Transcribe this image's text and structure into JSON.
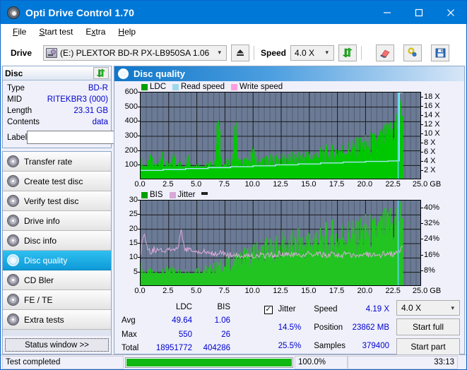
{
  "window": {
    "title": "Opti Drive Control 1.70",
    "icon": "disc-icon",
    "minimize": "minimize-icon",
    "maximize": "maximize-icon",
    "close": "close-icon"
  },
  "menu": [
    {
      "label": "File"
    },
    {
      "label": "Start test"
    },
    {
      "label": "Extra"
    },
    {
      "label": "Help"
    }
  ],
  "toolbar": {
    "drive_label": "Drive",
    "drive_value": "(E:)  PLEXTOR BD-R  PX-LB950SA 1.06",
    "eject_icon": "eject-icon",
    "speed_label": "Speed",
    "speed_value": "4.0 X",
    "refresh_icon": "refresh-icon",
    "erase_icon": "eraser-icon",
    "tools_icon": "tools-icon",
    "save_icon": "save-icon"
  },
  "disc": {
    "header": "Disc",
    "refresh_icon": "refresh-icon",
    "rows": [
      {
        "key": "Type",
        "value": "BD-R"
      },
      {
        "key": "MID",
        "value": "RITEKBR3 (000)"
      },
      {
        "key": "Length",
        "value": "23.31 GB"
      },
      {
        "key": "Contents",
        "value": "data"
      }
    ],
    "label_key": "Label",
    "label_value": "",
    "label_placeholder": "",
    "label_icon": "cd-icon"
  },
  "nav": {
    "items": [
      {
        "label": "Transfer rate",
        "icon": "disc-rate-icon",
        "active": false
      },
      {
        "label": "Create test disc",
        "icon": "disc-create-icon",
        "active": false
      },
      {
        "label": "Verify test disc",
        "icon": "disc-verify-icon",
        "active": false
      },
      {
        "label": "Drive info",
        "icon": "drive-info-icon",
        "active": false
      },
      {
        "label": "Disc info",
        "icon": "disc-info-icon",
        "active": false
      },
      {
        "label": "Disc quality",
        "icon": "disc-quality-icon",
        "active": true
      },
      {
        "label": "CD Bler",
        "icon": "cd-bler-icon",
        "active": false
      },
      {
        "label": "FE / TE",
        "icon": "fete-icon",
        "active": false
      },
      {
        "label": "Extra tests",
        "icon": "extra-tests-icon",
        "active": false
      }
    ],
    "status_window": "Status window >>"
  },
  "main": {
    "header": "Disc quality",
    "header_icon": "disc-quality-icon"
  },
  "stats": {
    "col_headers": [
      "",
      "LDC",
      "BIS"
    ],
    "rows": [
      {
        "label": "Avg",
        "ldc": "49.64",
        "bis": "1.06",
        "jitter": "14.5%"
      },
      {
        "label": "Max",
        "ldc": "550",
        "bis": "26",
        "jitter": "25.5%"
      },
      {
        "label": "Total",
        "ldc": "18951772",
        "bis": "404286",
        "jitter": ""
      }
    ],
    "jitter_label": "Jitter",
    "jitter_checked": true,
    "speed_label": "Speed",
    "speed_value": "4.19 X",
    "position_label": "Position",
    "position_value": "23862 MB",
    "samples_label": "Samples",
    "samples_value": "379400",
    "speed_select": "4.0 X",
    "start_full": "Start full",
    "start_part": "Start part"
  },
  "statusbar": {
    "message": "Test completed",
    "percent": "100.0%",
    "percent_value": 100,
    "elapsed": "33:13"
  },
  "colors": {
    "accent": "#0078d7",
    "plot_bg": "#6b7a95",
    "ldc": "#00b000",
    "bis": "#00a000",
    "read_speed": "#7ec8e8",
    "write_speed": "#ff8ad8",
    "jitter": "#d8a8d8",
    "value_text": "#0000cd",
    "progress": "#12b812"
  },
  "chart_data": [
    {
      "type": "line",
      "title": "Disc quality - LDC / Read speed",
      "xlabel": "GB",
      "ylabel": "",
      "xlim": [
        0,
        25
      ],
      "ylim": [
        0,
        600
      ],
      "xticks": [
        "0.0",
        "2.5",
        "5.0",
        "7.5",
        "10.0",
        "12.5",
        "15.0",
        "17.5",
        "20.0",
        "22.5",
        "25.0 GB"
      ],
      "yticks": [
        "100",
        "200",
        "300",
        "400",
        "500",
        "600"
      ],
      "y2ticks": [
        "2 X",
        "4 X",
        "6 X",
        "8 X",
        "10 X",
        "12 X",
        "14 X",
        "16 X",
        "18 X"
      ],
      "y2lim": [
        0,
        19
      ],
      "grid": true,
      "legend": [
        {
          "name": "LDC",
          "color": "#00b000"
        },
        {
          "name": "Read speed",
          "color": "#7ec8e8"
        },
        {
          "name": "Write speed",
          "color": "#ff8ad8"
        }
      ],
      "series": [
        {
          "name": "LDC",
          "kind": "impulse",
          "color": "#00c800",
          "x": [
            0.0,
            0.3,
            0.6,
            0.9,
            1.2,
            1.5,
            1.8,
            2.1,
            2.4,
            2.7,
            3.0,
            3.3,
            3.6,
            3.9,
            4.2,
            4.5,
            4.8,
            5.1,
            5.4,
            5.7,
            6.0,
            6.3,
            6.6,
            6.9,
            7.2,
            7.5,
            7.8,
            8.1,
            8.4,
            8.7,
            9.0,
            9.3,
            9.6,
            9.9,
            10.2,
            10.5,
            10.8,
            11.1,
            11.4,
            11.7,
            12.0,
            12.3,
            12.6,
            12.9,
            13.2,
            13.5,
            13.8,
            14.1,
            14.4,
            14.7,
            15.0,
            15.3,
            15.6,
            15.9,
            16.2,
            16.5,
            16.8,
            17.1,
            17.4,
            17.7,
            18.0,
            18.3,
            18.6,
            18.9,
            19.2,
            19.5,
            19.8,
            20.1,
            20.4,
            20.7,
            21.0,
            21.3,
            21.6,
            21.9,
            22.2,
            22.5,
            22.8,
            23.0,
            23.2
          ],
          "y": [
            125,
            90,
            95,
            140,
            95,
            100,
            190,
            95,
            100,
            90,
            180,
            95,
            100,
            95,
            180,
            95,
            90,
            95,
            100,
            95,
            95,
            100,
            105,
            410,
            120,
            110,
            115,
            110,
            400,
            115,
            115,
            120,
            125,
            200,
            130,
            125,
            130,
            135,
            130,
            135,
            140,
            135,
            140,
            145,
            140,
            150,
            145,
            150,
            155,
            160,
            155,
            160,
            165,
            170,
            175,
            185,
            190,
            180,
            195,
            200,
            195,
            205,
            210,
            215,
            220,
            230,
            225,
            240,
            250,
            245,
            260,
            270,
            280,
            300,
            320,
            350,
            380,
            430,
            480
          ]
        },
        {
          "name": "Read speed",
          "kind": "step",
          "color": "#a8e8f8",
          "x": [
            0.0,
            2.0,
            4.0,
            6.0,
            8.0,
            10.0,
            12.0,
            14.0,
            16.0,
            18.0,
            20.0,
            22.0,
            22.8,
            23.0
          ],
          "y": [
            2.1,
            2.3,
            2.5,
            2.7,
            2.9,
            3.1,
            3.3,
            3.5,
            3.7,
            3.9,
            4.05,
            4.15,
            4.19,
            19.0
          ]
        }
      ]
    },
    {
      "type": "line",
      "title": "Disc quality - BIS / Jitter",
      "xlabel": "GB",
      "ylabel": "",
      "xlim": [
        0,
        25
      ],
      "ylim": [
        0,
        30
      ],
      "xticks": [
        "0.0",
        "2.5",
        "5.0",
        "7.5",
        "10.0",
        "12.5",
        "15.0",
        "17.5",
        "20.0",
        "22.5",
        "25.0 GB"
      ],
      "yticks": [
        "5",
        "10",
        "15",
        "20",
        "25",
        "30"
      ],
      "y2ticks": [
        "8%",
        "16%",
        "24%",
        "32%",
        "40%"
      ],
      "y2lim": [
        0,
        44
      ],
      "grid": true,
      "legend": [
        {
          "name": "BIS",
          "color": "#00b000"
        },
        {
          "name": "Jitter",
          "color": "#d8a8d8"
        }
      ],
      "series": [
        {
          "name": "BIS",
          "kind": "impulse",
          "color": "#22c422",
          "x": [
            0.0,
            0.3,
            0.6,
            0.9,
            1.2,
            1.5,
            1.8,
            2.1,
            2.4,
            2.7,
            3.0,
            3.3,
            3.6,
            3.9,
            4.2,
            4.5,
            4.8,
            5.1,
            5.4,
            5.7,
            6.0,
            6.3,
            6.6,
            6.9,
            7.2,
            7.5,
            7.8,
            8.1,
            8.4,
            8.7,
            9.0,
            9.3,
            9.6,
            9.9,
            10.2,
            10.5,
            10.8,
            11.1,
            11.4,
            11.7,
            12.0,
            12.3,
            12.6,
            12.9,
            13.2,
            13.5,
            13.8,
            14.1,
            14.4,
            14.7,
            15.0,
            15.3,
            15.6,
            15.9,
            16.2,
            16.5,
            16.8,
            17.1,
            17.4,
            17.7,
            18.0,
            18.3,
            18.6,
            18.9,
            19.2,
            19.5,
            19.8,
            20.1,
            20.4,
            20.7,
            21.0,
            21.3,
            21.6,
            21.9,
            22.2,
            22.5,
            22.8,
            23.0,
            23.2
          ],
          "y": [
            7,
            5,
            4.5,
            5,
            4,
            5,
            4.5,
            5,
            5.5,
            5,
            6.5,
            5,
            4.5,
            5,
            5,
            4.5,
            5,
            6,
            5,
            6,
            5.5,
            6,
            6.5,
            7,
            8,
            7,
            9,
            8,
            10,
            9,
            10,
            11,
            10,
            12,
            11,
            13,
            12,
            14,
            13,
            12,
            14,
            13,
            15,
            14,
            13,
            15,
            14,
            16,
            15,
            14,
            16,
            15,
            17,
            16,
            15,
            17,
            16,
            18,
            17,
            16,
            18,
            17,
            19,
            18,
            17,
            19,
            18,
            20,
            19,
            18,
            20,
            19,
            21,
            20,
            22,
            21,
            23,
            24,
            26
          ]
        },
        {
          "name": "Jitter",
          "kind": "line",
          "color": "#dda8dd",
          "x": [
            0.0,
            0.3,
            0.6,
            0.9,
            1.2,
            1.5,
            1.8,
            2.1,
            2.4,
            2.7,
            3.0,
            3.3,
            3.6,
            3.9,
            4.2,
            4.5,
            4.8,
            5.1,
            5.4,
            5.7,
            6.0,
            6.3,
            6.6,
            6.9,
            7.2,
            7.5,
            7.8,
            8.1,
            8.4,
            8.7,
            9.0,
            9.3,
            9.6,
            9.9,
            10.2,
            10.5,
            10.8,
            11.1,
            11.4,
            11.7,
            12.0,
            12.3,
            12.6,
            12.9,
            13.2,
            13.5,
            13.8,
            14.1,
            14.4,
            14.7,
            15.0,
            15.3,
            15.6,
            15.9,
            16.2,
            16.5,
            16.8,
            17.1,
            17.4,
            17.7,
            18.0,
            18.3,
            18.6,
            18.9,
            19.2,
            19.5,
            19.8,
            20.1,
            20.4,
            20.7,
            21.0,
            21.3,
            21.6,
            21.9,
            22.2,
            22.5,
            22.8,
            23.0,
            23.2
          ],
          "y": [
            12,
            19,
            14,
            12,
            13,
            12.5,
            13,
            12.5,
            13,
            13.5,
            13,
            12.5,
            19.5,
            13,
            13,
            12.5,
            12,
            12,
            12.5,
            12,
            11.5,
            12,
            11.5,
            11.5,
            12,
            11.5,
            11,
            11,
            10.5,
            11,
            11,
            10.5,
            11,
            11,
            10.5,
            11,
            11,
            10.5,
            11,
            11,
            11,
            11.5,
            11,
            11,
            11.5,
            11,
            11,
            11.5,
            11,
            11,
            11.5,
            11,
            11,
            11.5,
            11,
            11,
            11,
            11.5,
            11,
            11,
            11,
            11.5,
            11,
            11,
            11,
            11,
            11,
            11.5,
            11,
            11,
            11,
            11,
            11.5,
            11,
            11.5,
            11,
            11.5,
            12,
            14.5
          ]
        }
      ]
    }
  ]
}
